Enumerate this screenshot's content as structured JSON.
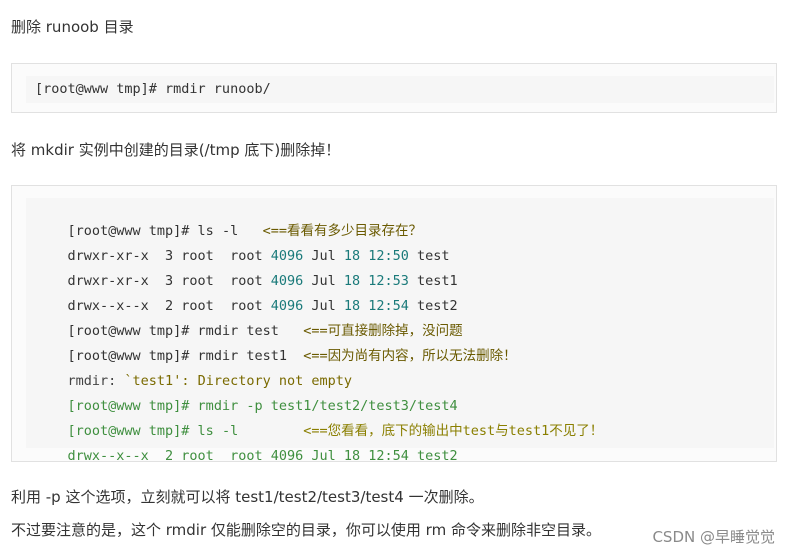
{
  "paragraphs": {
    "p1": "删除 runoob 目录",
    "p2": "将 mkdir 实例中创建的目录(/tmp 底下)删除掉！",
    "p3": "利用 -p 这个选项，立刻就可以将 test1/test2/test3/test4 一次删除。",
    "p4": "不过要注意的是，这个 rmdir 仅能删除空的目录，你可以使用 rm 命令来删除非空目录。"
  },
  "code1": {
    "line1": "[root@www tmp]# rmdir runoob/"
  },
  "code2": {
    "l1_cmd": "[root@www tmp]# ls -l   ",
    "l1_comment": "<==看看有多少目录存在？",
    "l2_a": "drwxr-xr-x  3 root  root ",
    "l2_num": "4096",
    "l2_b": " Jul ",
    "l2_c": "18 12:50",
    "l2_d": " test",
    "l3_a": "drwxr-xr-x  3 root  root ",
    "l3_num": "4096",
    "l3_b": " Jul ",
    "l3_c": "18 12:53",
    "l3_d": " test1",
    "l4_a": "drwx--x--x  2 root  root ",
    "l4_num": "4096",
    "l4_b": " Jul ",
    "l4_c": "18 12:54",
    "l4_d": " test2",
    "l5_cmd": "[root@www tmp]# rmdir test   ",
    "l5_comment": "<==可直接删除掉，没问题",
    "l6_cmd": "[root@www tmp]# rmdir test1  ",
    "l6_comment": "<==因为尚有内容，所以无法删除！",
    "l7_a": "rmdir: ",
    "l7_str": "`test1': Directory not empty",
    "l8_cmd": "[root@www tmp]# rmdir -p test1/test2/test3/test4",
    "l9_cmd": "[root@www tmp]# ls -l        ",
    "l9_comment": "<==您看看，底下的输出中test与test1不见了！",
    "l10": "drwx--x--x  2 root  root 4096 Jul 18 12:54 test2"
  },
  "watermark": "CSDN @早睡觉觉"
}
